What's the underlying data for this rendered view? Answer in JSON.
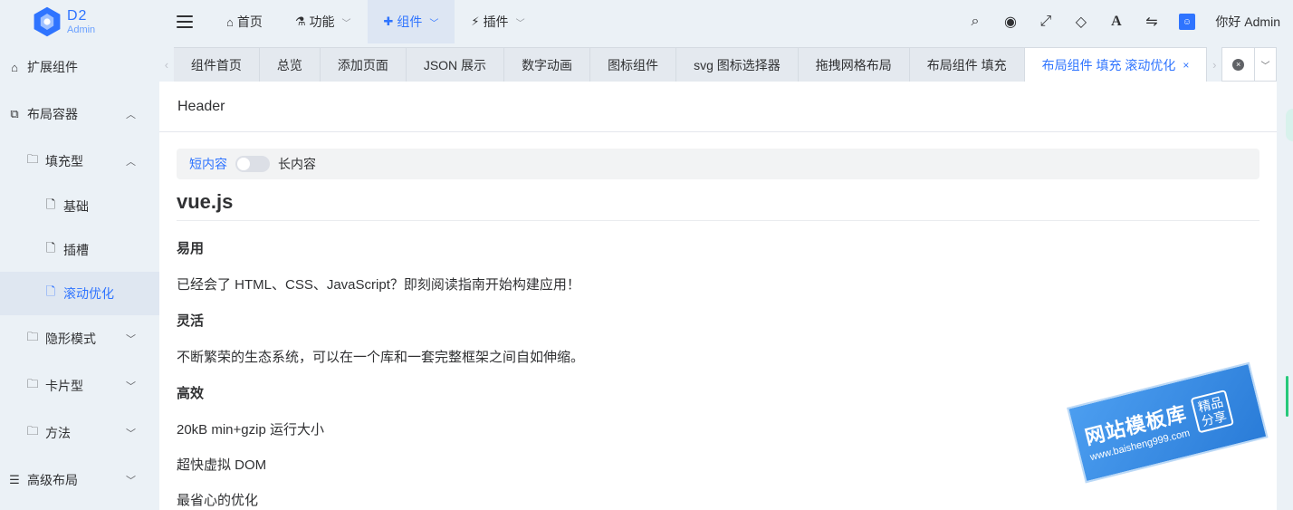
{
  "app": {
    "logo_title": "D2",
    "logo_sub": "Admin"
  },
  "topmenu": [
    {
      "label": "首页",
      "icon": "home-icon",
      "glyph": "⌂",
      "has_arrow": false
    },
    {
      "label": "功能",
      "icon": "flask-icon",
      "glyph": "⚗",
      "has_arrow": true
    },
    {
      "label": "组件",
      "icon": "puzzle-icon",
      "glyph": "✚",
      "has_arrow": true,
      "active": true
    },
    {
      "label": "插件",
      "icon": "plug-icon",
      "glyph": "⚡",
      "has_arrow": true
    }
  ],
  "tools": {
    "search": "⌕",
    "target": "◉",
    "fullscreen": "⤢",
    "diamond": "◇",
    "font": "A",
    "translate": "⇋",
    "user_box": "☺",
    "greeting": "你好 Admin"
  },
  "sidebar": [
    {
      "label": "扩展组件",
      "level": 1,
      "icon": "home-icon",
      "glyph": "⌂",
      "arrow": ""
    },
    {
      "label": "布局容器",
      "level": 1,
      "icon": "clone-icon",
      "glyph": "⧉",
      "arrow": "︿"
    },
    {
      "label": "填充型",
      "level": 2,
      "icon": "folder-icon",
      "glyph": "🗀",
      "arrow": "︿"
    },
    {
      "label": "基础",
      "level": 3,
      "icon": "file-icon",
      "glyph": "🗋",
      "arrow": ""
    },
    {
      "label": "插槽",
      "level": 3,
      "icon": "file-icon",
      "glyph": "🗋",
      "arrow": ""
    },
    {
      "label": "滚动优化",
      "level": 3,
      "icon": "file-icon",
      "glyph": "🗋",
      "arrow": "",
      "active": true
    },
    {
      "label": "隐形模式",
      "level": 2,
      "icon": "folder-icon",
      "glyph": "🗀",
      "arrow": "﹀"
    },
    {
      "label": "卡片型",
      "level": 2,
      "icon": "folder-icon",
      "glyph": "🗀",
      "arrow": "﹀"
    },
    {
      "label": "方法",
      "level": 2,
      "icon": "folder-icon",
      "glyph": "🗀",
      "arrow": "﹀"
    },
    {
      "label": "高级布局",
      "level": 1,
      "icon": "server-icon",
      "glyph": "☰",
      "arrow": "﹀"
    }
  ],
  "tabs": [
    {
      "label": "组件首页"
    },
    {
      "label": "总览"
    },
    {
      "label": "添加页面"
    },
    {
      "label": "JSON 展示"
    },
    {
      "label": "数字动画"
    },
    {
      "label": "图标组件"
    },
    {
      "label": "svg 图标选择器"
    },
    {
      "label": "拖拽网格布局"
    },
    {
      "label": "布局组件 填充"
    },
    {
      "label": "布局组件 填充 滚动优化",
      "active": true,
      "close": "×"
    }
  ],
  "tab_controls": {
    "left_arrow": "‹",
    "right_arrow": "›",
    "close_all": "×",
    "dropdown": "﹀"
  },
  "main": {
    "header": "Header",
    "switch_left": "短内容",
    "switch_right": "长内容",
    "switch_on": false,
    "title": "vue.js",
    "blocks": [
      {
        "type": "h3",
        "text": "易用"
      },
      {
        "type": "p",
        "text": "已经会了 HTML、CSS、JavaScript？即刻阅读指南开始构建应用！"
      },
      {
        "type": "h3",
        "text": "灵活"
      },
      {
        "type": "p",
        "text": "不断繁荣的生态系统，可以在一个库和一套完整框架之间自如伸缩。"
      },
      {
        "type": "h3",
        "text": "高效"
      },
      {
        "type": "p",
        "text": "20kB min+gzip 运行大小"
      },
      {
        "type": "p",
        "text": "超快虚拟 DOM"
      },
      {
        "type": "p",
        "text": "最省心的优化"
      }
    ]
  },
  "watermark": {
    "title": "网站模板库",
    "url": "www.baisheng999.com",
    "tag": "精品分享"
  },
  "colors": {
    "accent": "#2f74ff",
    "bg": "#ebf1f6",
    "scroll_thumb": "#27c97a"
  }
}
